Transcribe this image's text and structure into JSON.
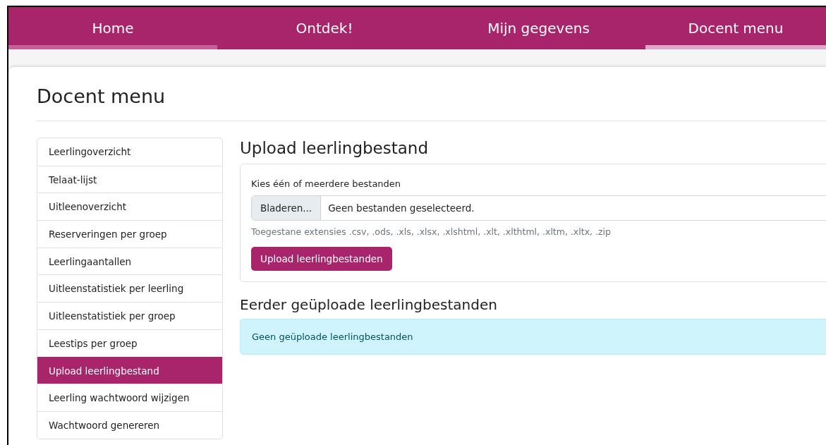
{
  "nav": {
    "tabs": [
      {
        "label": "Home",
        "selected": false,
        "hovered": true
      },
      {
        "label": "Ontdek!",
        "selected": false,
        "hovered": false
      },
      {
        "label": "Mijn gegevens",
        "selected": false,
        "hovered": false
      },
      {
        "label": "Docent menu",
        "selected": true,
        "hovered": false
      }
    ]
  },
  "page": {
    "title": "Docent menu"
  },
  "sidebar": {
    "items": [
      {
        "label": "Leerlingoverzicht",
        "selected": false
      },
      {
        "label": "Telaat-lijst",
        "selected": false
      },
      {
        "label": "Uitleenoverzicht",
        "selected": false
      },
      {
        "label": "Reserveringen per groep",
        "selected": false
      },
      {
        "label": "Leerlingaantallen",
        "selected": false
      },
      {
        "label": "Uitleenstatistiek per leerling",
        "selected": false
      },
      {
        "label": "Uitleenstatistiek per groep",
        "selected": false
      },
      {
        "label": "Leestips per groep",
        "selected": false
      },
      {
        "label": "Upload leerlingbestand",
        "selected": true
      },
      {
        "label": "Leerling wachtwoord wijzigen",
        "selected": false
      },
      {
        "label": "Wachtwoord genereren",
        "selected": false
      }
    ]
  },
  "upload": {
    "heading": "Upload leerlingbestand",
    "field_label": "Kies één of meerdere bestanden",
    "browse_button": "Bladeren...",
    "file_placeholder": "Geen bestanden geselecteerd.",
    "help_text": "Toegestane extensies .csv, .ods, .xls, .xlsx, .xlshtml, .xlt, .xlthtml, .xltm, .xltx, .zip",
    "submit_button": "Upload leerlingbestanden"
  },
  "previous": {
    "heading": "Eerder geüploade leerlingbestanden",
    "alert": "Geen geüploade leerlingbestanden"
  }
}
